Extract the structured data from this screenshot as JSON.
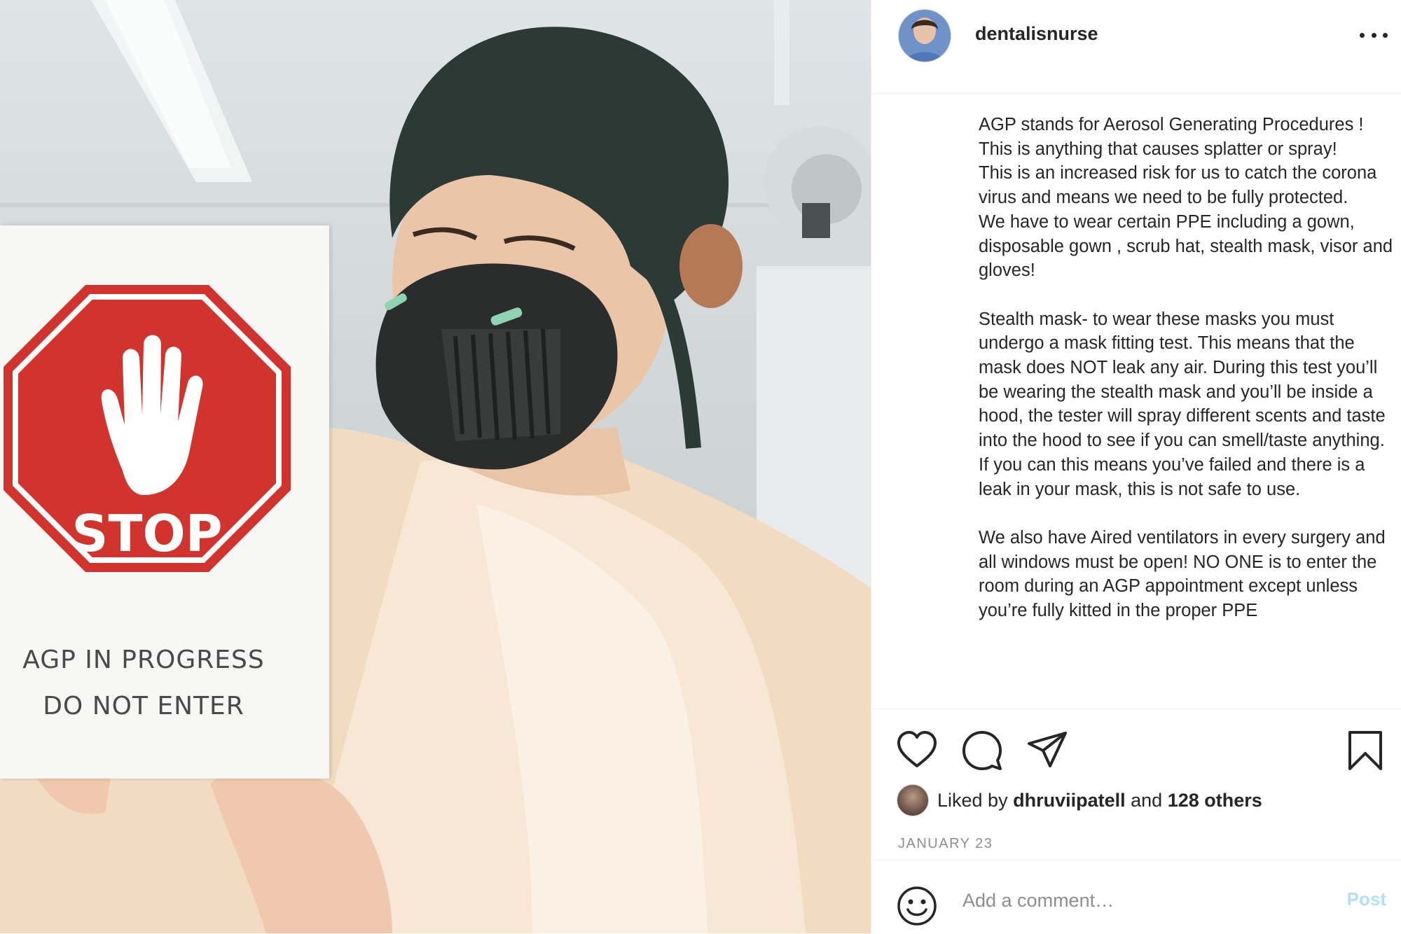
{
  "post": {
    "username": "dentalisnurse",
    "caption": "AGP stands for Aerosol Generating Procedures ! This is anything that causes splatter or spray!\nThis is an increased risk for us to catch the corona virus and means we need to be fully protected.\nWe have to wear certain PPE including a gown, disposable gown , scrub hat, stealth mask, visor and gloves!\n\nStealth mask- to wear these masks you must undergo a mask fitting test. This means that the mask does NOT leak any air. During this test you’ll be wearing the stealth mask and you’ll be inside a hood, the tester will spray different scents and taste into the hood to see if you can smell/taste anything. If you can this means you’ve failed and there is a leak in your mask, this is not safe to use.\n\nWe also have Aired ventilators in every surgery and all windows must be open! NO ONE is to enter the room during an AGP appointment except unless you’re fully kitted in the proper PPE",
    "likes": {
      "prefix": "Liked by",
      "user": "dhruviipatell",
      "conjunction": "and",
      "others": "128 others"
    },
    "date": "JANUARY 23"
  },
  "photo": {
    "sign": {
      "stop_text": "STOP",
      "line1": "AGP IN PROGRESS",
      "line2": "DO NOT ENTER"
    }
  },
  "actions": {
    "like_icon": "heart-icon",
    "comment_icon": "comment-icon",
    "share_icon": "paper-plane-icon",
    "save_icon": "bookmark-icon",
    "more_icon": "more-options-icon"
  },
  "comment_box": {
    "placeholder": "Add a comment…",
    "post_label": "Post",
    "emoji_icon": "smiley-icon"
  },
  "colors": {
    "stop_red": "#d0342c",
    "post_disabled": "#b2dffc",
    "muted_text": "#8e8e8e"
  }
}
